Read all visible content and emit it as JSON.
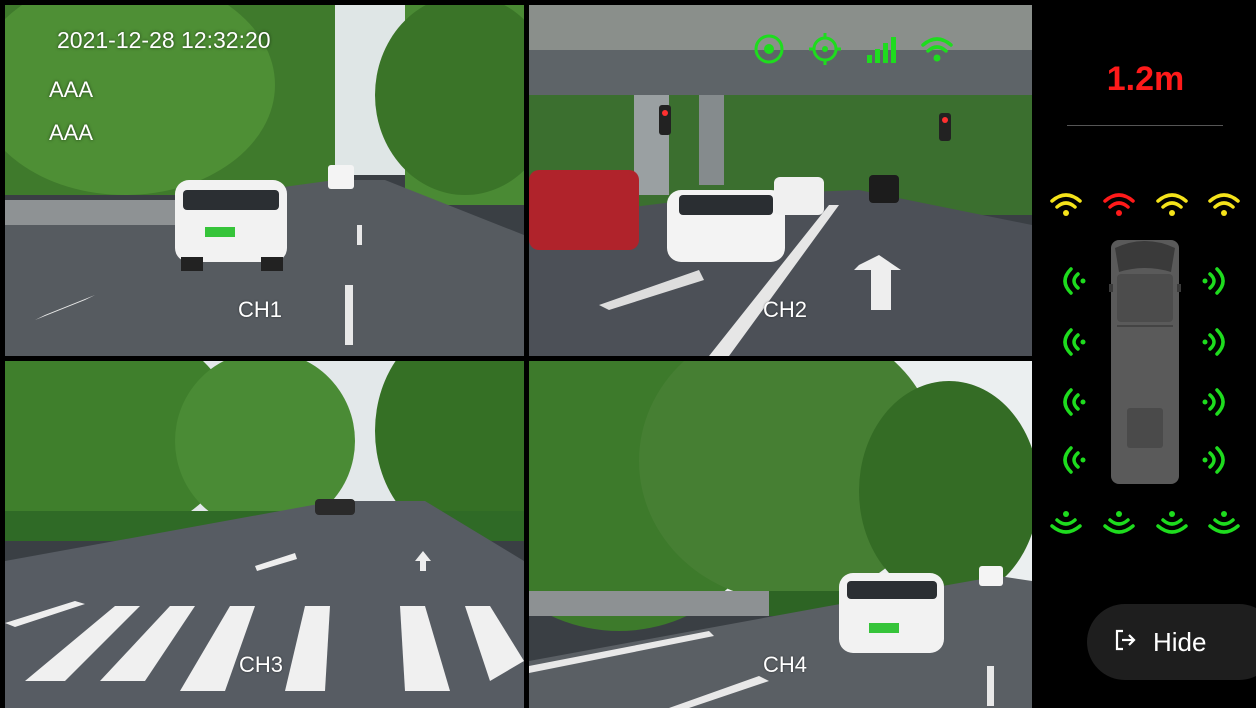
{
  "overlay": {
    "datetime": "2021-12-28 12:32:20",
    "line1": "AAA",
    "line2": "AAA"
  },
  "channels": [
    {
      "label": "CH1"
    },
    {
      "label": "CH2"
    },
    {
      "label": "CH3"
    },
    {
      "label": "CH4"
    }
  ],
  "status_icons": [
    "record-icon",
    "gps-icon",
    "signal-bars-icon",
    "wifi-icon"
  ],
  "radar": {
    "distance": "1.2m",
    "front_sensors": [
      "yellow",
      "red",
      "yellow",
      "yellow"
    ],
    "rear_sensors": [
      "green",
      "green",
      "green",
      "green"
    ],
    "left_sensors": [
      "green",
      "green",
      "green",
      "green"
    ],
    "right_sensors": [
      "green",
      "green",
      "green",
      "green"
    ]
  },
  "colors": {
    "warning_red": "#ff1a1a",
    "caution_yellow": "#f5e31a",
    "ok_green": "#1edc1e"
  },
  "hide_button": {
    "label": "Hide",
    "icon": "exit-icon"
  }
}
